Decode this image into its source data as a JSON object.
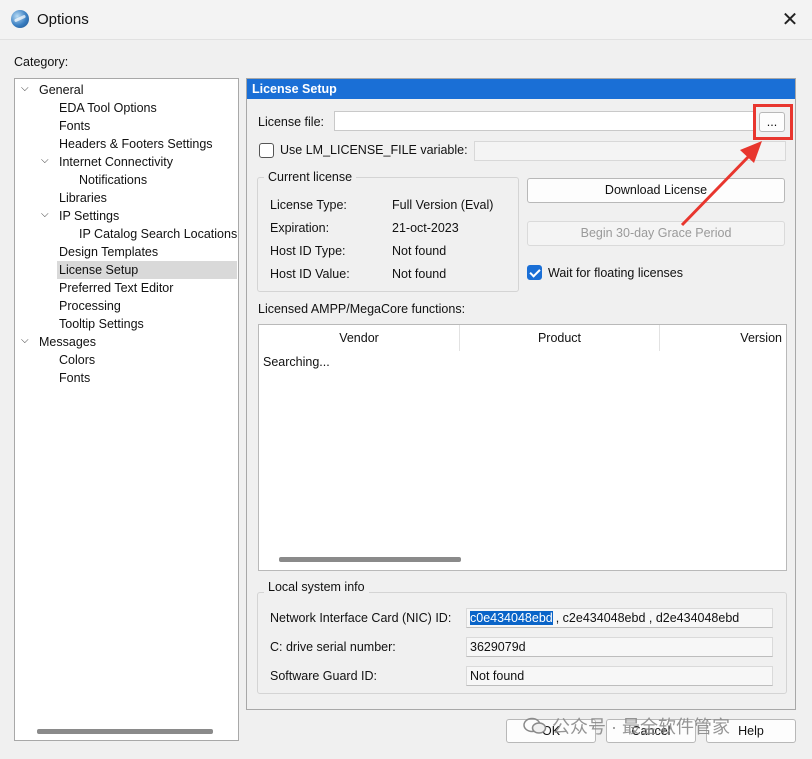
{
  "window": {
    "title": "Options",
    "close_glyph": "✕"
  },
  "category_label": "Category:",
  "tree": {
    "items": [
      {
        "label": "General",
        "level": 0,
        "expandable": true
      },
      {
        "label": "EDA Tool Options",
        "level": 1,
        "expandable": false
      },
      {
        "label": "Fonts",
        "level": 1,
        "expandable": false
      },
      {
        "label": "Headers & Footers Settings",
        "level": 1,
        "expandable": false
      },
      {
        "label": "Internet Connectivity",
        "level": 1,
        "expandable": true
      },
      {
        "label": "Notifications",
        "level": 2,
        "expandable": false
      },
      {
        "label": "Libraries",
        "level": 1,
        "expandable": false
      },
      {
        "label": "IP Settings",
        "level": 1,
        "expandable": true
      },
      {
        "label": "IP Catalog Search Locations",
        "level": 2,
        "expandable": false
      },
      {
        "label": "Design Templates",
        "level": 1,
        "expandable": false
      },
      {
        "label": "License Setup",
        "level": 1,
        "expandable": false,
        "selected": true
      },
      {
        "label": "Preferred Text Editor",
        "level": 1,
        "expandable": false
      },
      {
        "label": "Processing",
        "level": 1,
        "expandable": false
      },
      {
        "label": "Tooltip Settings",
        "level": 1,
        "expandable": false
      },
      {
        "label": "Messages",
        "level": 0,
        "expandable": true
      },
      {
        "label": "Colors",
        "level": 1,
        "expandable": false
      },
      {
        "label": "Fonts",
        "level": 1,
        "expandable": false
      }
    ],
    "chevron_glyph": "⌵"
  },
  "panel": {
    "header": "License Setup",
    "license_file_label": "License file:",
    "license_file_value": "",
    "browse_label": "...",
    "use_env_label": "Use LM_LICENSE_FILE variable:",
    "use_env_checked": false,
    "current_license": {
      "title": "Current license",
      "rows": [
        {
          "label": "License Type:",
          "value": "Full Version (Eval)"
        },
        {
          "label": "Expiration:",
          "value": "21-oct-2023"
        },
        {
          "label": "Host ID Type:",
          "value": "Not found"
        },
        {
          "label": "Host ID Value:",
          "value": "Not found"
        }
      ]
    },
    "download_label": "Download License",
    "grace_label": "Begin 30-day Grace Period",
    "wait_floating_label": "Wait for floating licenses",
    "wait_floating_checked": true,
    "functions_label": "Licensed AMPP/MegaCore functions:",
    "columns": [
      "Vendor",
      "Product",
      "Version"
    ],
    "list_status": "Searching...",
    "local_info": {
      "title": "Local system info",
      "nic_label": "Network Interface Card (NIC) ID:",
      "nic_selected": "c0e434048ebd",
      "nic_rest": ", c2e434048ebd , d2e434048ebd",
      "drive_label": "C: drive serial number:",
      "drive_value": "3629079d",
      "guard_label": "Software Guard ID:",
      "guard_value": "Not found"
    }
  },
  "buttons": {
    "ok": "OK",
    "cancel": "Cancel",
    "help": "Help"
  },
  "watermark": "公众号 · 最全软件管家",
  "colors": {
    "header_blue": "#1a6fd6",
    "annotation_red": "#e8362e",
    "selection_blue": "#0a64c8"
  }
}
